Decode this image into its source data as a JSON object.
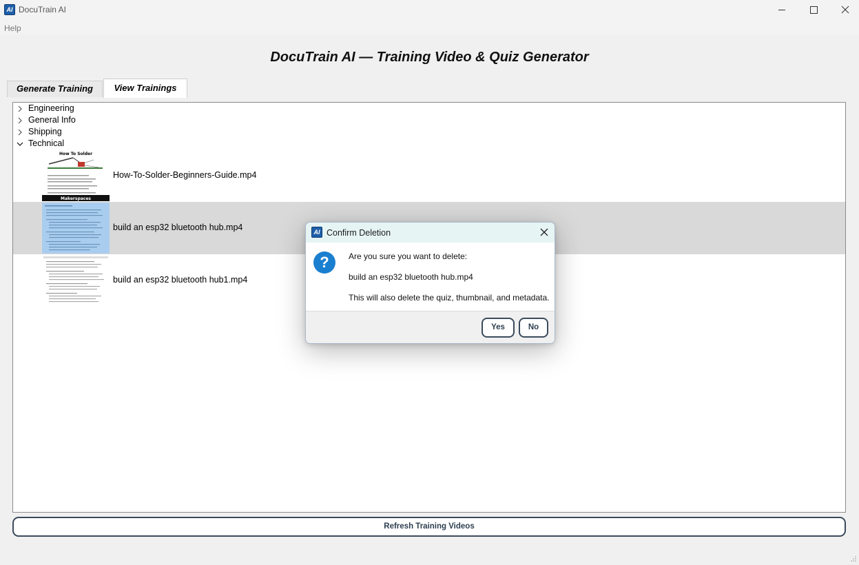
{
  "window": {
    "icon_text": "AI",
    "title": "DocuTrain AI",
    "controls": [
      "minimize-icon",
      "maximize-icon",
      "close-icon"
    ]
  },
  "menu": {
    "help": "Help"
  },
  "main_title": "DocuTrain AI — Training Video & Quiz Generator",
  "tabs": [
    {
      "label": "Generate Training",
      "active": false
    },
    {
      "label": "View Trainings",
      "active": true
    }
  ],
  "tree": {
    "categories": [
      {
        "label": "Engineering",
        "expanded": false
      },
      {
        "label": "General Info",
        "expanded": false
      },
      {
        "label": "Shipping",
        "expanded": false
      },
      {
        "label": "Technical",
        "expanded": true
      }
    ],
    "videos": [
      {
        "label": "How-To-Solder-Beginners-Guide.mp4",
        "thumb_title": "How To Solder",
        "thumb_footer": "Makerspaces",
        "selected": false
      },
      {
        "label": "build an esp32 bluetooth hub.mp4",
        "selected": true
      },
      {
        "label": "build an esp32 bluetooth hub1.mp4",
        "selected": false
      }
    ]
  },
  "refresh_button": "Refresh Training Videos",
  "dialog": {
    "icon_text": "AI",
    "title": "Confirm Deletion",
    "question_icon": "?",
    "line1": "Are you sure you want to delete:",
    "line2": "build an esp32 bluetooth hub.mp4",
    "line3": "This will also delete the quiz, thumbnail, and metadata.",
    "yes": "Yes",
    "no": "No"
  },
  "colors": {
    "accent": "#1f5fa8",
    "selection": "#d9d9d9",
    "button_border": "#3a4a5c",
    "question_icon": "#1b7fd0"
  }
}
